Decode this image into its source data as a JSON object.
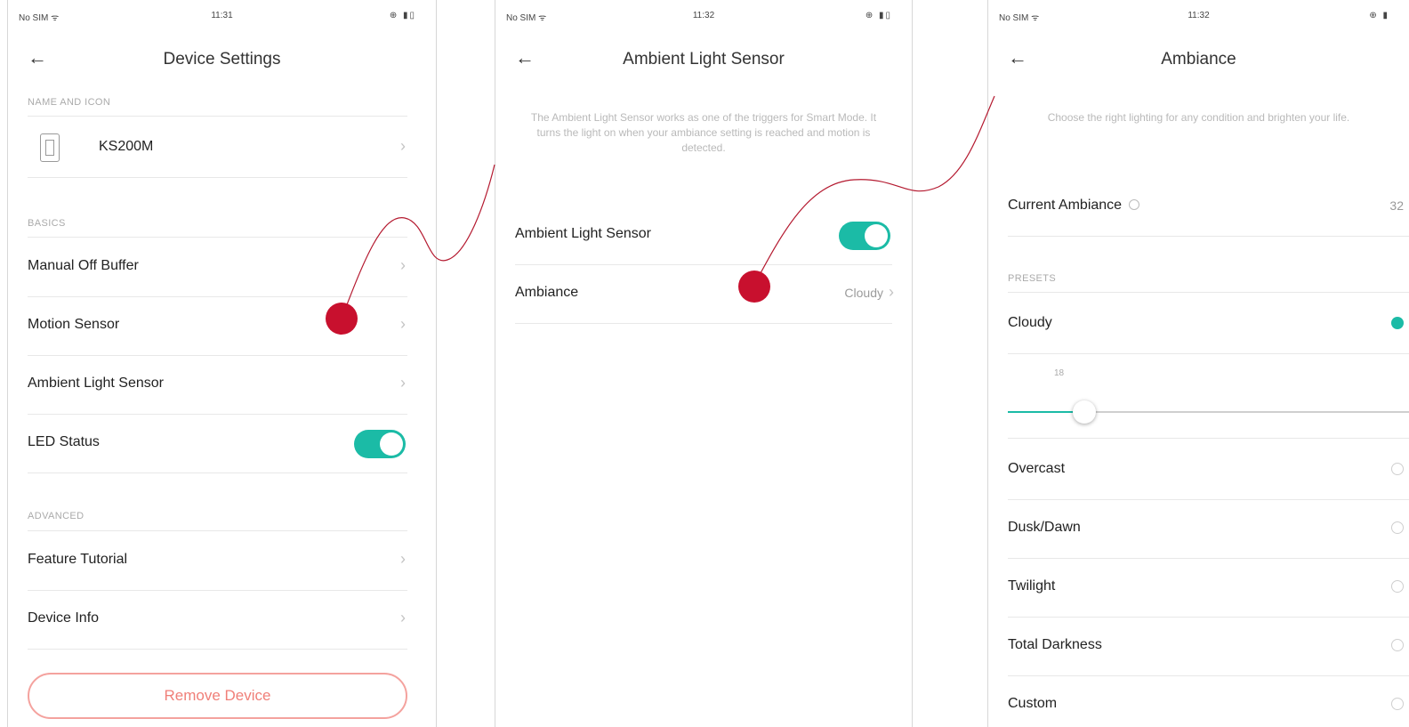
{
  "screen1": {
    "status": {
      "carrier": "No SIM ᯤ",
      "time": "11:31",
      "battery": "⊕ ▮▯"
    },
    "title": "Device Settings",
    "sections": {
      "name_icon": "NAME AND ICON",
      "basics": "BASICS",
      "advanced": "ADVANCED"
    },
    "device_name": "KS200M",
    "items": {
      "manual_off": "Manual Off Buffer",
      "motion": "Motion Sensor",
      "ambient": "Ambient Light Sensor",
      "led": "LED Status",
      "tutorial": "Feature Tutorial",
      "info": "Device Info"
    },
    "led_on": true,
    "remove_label": "Remove Device"
  },
  "screen2": {
    "status": {
      "carrier": "No SIM ᯤ",
      "time": "11:32",
      "battery": "⊕ ▮▯"
    },
    "title": "Ambient Light Sensor",
    "description": "The Ambient Light Sensor works as one of the triggers for Smart Mode. It turns the light on when your ambiance setting is reached and motion is detected.",
    "toggle_label": "Ambient Light Sensor",
    "toggle_on": true,
    "ambiance_label": "Ambiance",
    "ambiance_value": "Cloudy"
  },
  "screen3": {
    "status": {
      "carrier": "No SIM ᯤ",
      "time": "11:32",
      "battery": "⊕ ▮"
    },
    "title": "Ambiance",
    "description": "Choose the right lighting for any condition and brighten your life.",
    "current_label": "Current Ambiance",
    "current_value": "32",
    "presets_label": "PRESETS",
    "slider_value": "18",
    "slider_fraction": 0.19,
    "presets": {
      "cloudy": "Cloudy",
      "overcast": "Overcast",
      "dusk": "Dusk/Dawn",
      "twilight": "Twilight",
      "darkness": "Total Darkness",
      "custom": "Custom"
    },
    "selected_preset": "Cloudy"
  },
  "colors": {
    "accent": "#1bbba6",
    "marker": "#c8102e",
    "remove": "#f07f78"
  },
  "icons": {
    "back": "←",
    "chevron": "›"
  }
}
